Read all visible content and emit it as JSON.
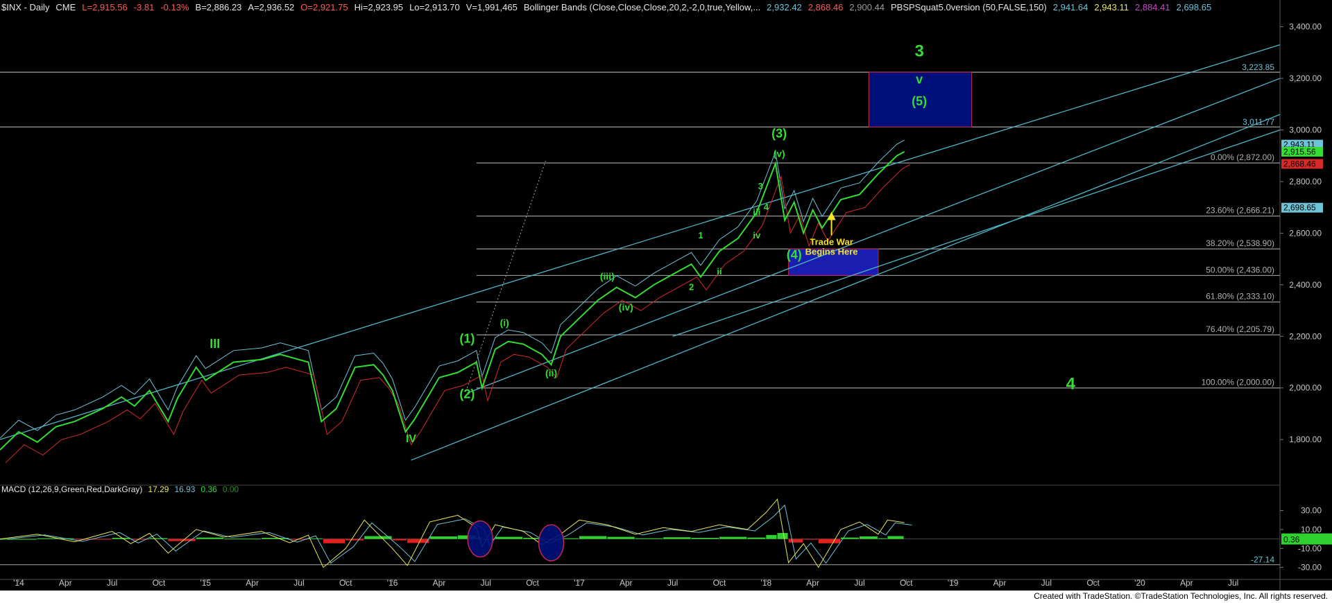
{
  "header": {
    "symbol": "$INX - Daily",
    "exchange": "CME",
    "last": "L=2,915.56",
    "chg": "-3.81",
    "chgpct": "-0.13%",
    "bid": "B=2,886.23",
    "ask": "A=2,936.52",
    "open": "O=2,921.75",
    "high": "Hi=2,923.95",
    "low": "Lo=2,913.70",
    "vol": "V=1,991,465",
    "bb_label": "Bollinger Bands (Close,Close,Close,20,2,-2,0,true,Yellow,...",
    "bb_v1": "2,932.42",
    "bb_v2": "2,868.46",
    "bb_v3": "2,900.44",
    "pbs_label": "PBSPSquat5.0version (50,FALSE,150)",
    "pbs_v1": "2,941.64",
    "pbs_v2": "2,943.11",
    "pbs_v3": "2,884.41",
    "pbs_v4": "2,698.65"
  },
  "macd_header": {
    "label": "MACD (12,26,9,Green,Red,DarkGray)",
    "v1": "17.29",
    "v2": "16.93",
    "v3": "0.36",
    "v4": "0.00"
  },
  "footer": "Created with TradeStation. ©TradeStation Technologies, Inc. All rights reserved.",
  "colors": {
    "price": "#33dd33",
    "bb_upper": "#6fc3d6",
    "bb_lower": "#d42a2a",
    "channel": "#4fb7c9",
    "wave_label": "#33dd33",
    "fib_label": "#b0b0b0",
    "box": "#00107a"
  },
  "chart_data": {
    "type": "line",
    "title": "$INX - Daily",
    "x_ticks": [
      "'14",
      "Apr",
      "Jul",
      "Oct",
      "'15",
      "Apr",
      "Jul",
      "Oct",
      "'16",
      "Apr",
      "Jul",
      "Oct",
      "'17",
      "Apr",
      "Jul",
      "Oct",
      "'18",
      "Apr",
      "Jul",
      "Oct",
      "'19",
      "Apr",
      "Jul",
      "Oct",
      "'20",
      "Apr",
      "Jul"
    ],
    "ylim": [
      1650,
      3450
    ],
    "y_ticks": [
      "3,400.00",
      "3,200.00",
      "3,000.00",
      "2,800.00",
      "2,600.00",
      "2,400.00",
      "2,200.00",
      "2,000.00",
      "1,800.00"
    ],
    "price_path": [
      [
        2013.9,
        1760
      ],
      [
        2014.0,
        1830
      ],
      [
        2014.1,
        1790
      ],
      [
        2014.2,
        1850
      ],
      [
        2014.3,
        1870
      ],
      [
        2014.45,
        1920
      ],
      [
        2014.55,
        1965
      ],
      [
        2014.62,
        1930
      ],
      [
        2014.7,
        1990
      ],
      [
        2014.8,
        1870
      ],
      [
        2014.85,
        1960
      ],
      [
        2014.95,
        2080
      ],
      [
        2015.0,
        2030
      ],
      [
        2015.15,
        2100
      ],
      [
        2015.3,
        2110
      ],
      [
        2015.4,
        2130
      ],
      [
        2015.55,
        2100
      ],
      [
        2015.62,
        1870
      ],
      [
        2015.7,
        1920
      ],
      [
        2015.8,
        2080
      ],
      [
        2015.9,
        2090
      ],
      [
        2015.95,
        2050
      ],
      [
        2016.0,
        1990
      ],
      [
        2016.07,
        1830
      ],
      [
        2016.12,
        1880
      ],
      [
        2016.25,
        2040
      ],
      [
        2016.35,
        2060
      ],
      [
        2016.45,
        2100
      ],
      [
        2016.48,
        2000
      ],
      [
        2016.55,
        2150
      ],
      [
        2016.62,
        2180
      ],
      [
        2016.7,
        2170
      ],
      [
        2016.8,
        2130
      ],
      [
        2016.85,
        2090
      ],
      [
        2016.9,
        2200
      ],
      [
        2017.0,
        2270
      ],
      [
        2017.1,
        2340
      ],
      [
        2017.2,
        2390
      ],
      [
        2017.3,
        2350
      ],
      [
        2017.4,
        2400
      ],
      [
        2017.5,
        2440
      ],
      [
        2017.6,
        2480
      ],
      [
        2017.65,
        2430
      ],
      [
        2017.75,
        2530
      ],
      [
        2017.85,
        2580
      ],
      [
        2017.95,
        2680
      ],
      [
        2018.05,
        2870
      ],
      [
        2018.1,
        2650
      ],
      [
        2018.15,
        2720
      ],
      [
        2018.2,
        2600
      ],
      [
        2018.25,
        2690
      ],
      [
        2018.3,
        2620
      ],
      [
        2018.4,
        2730
      ],
      [
        2018.5,
        2750
      ],
      [
        2018.6,
        2830
      ],
      [
        2018.7,
        2900
      ],
      [
        2018.74,
        2915.56
      ]
    ],
    "fib_levels": [
      {
        "label": "0.00% (2,872.00)",
        "value": 2872.0
      },
      {
        "label": "23.60% (2,666.21)",
        "value": 2666.21
      },
      {
        "label": "38.20% (2,538.90)",
        "value": 2538.9
      },
      {
        "label": "50.00% (2,436.00)",
        "value": 2436.0
      },
      {
        "label": "61.80% (2,333.10)",
        "value": 2333.1
      },
      {
        "label": "76.40% (2,205.79)",
        "value": 2205.79
      },
      {
        "label": "100.00% (2,000.00)",
        "value": 2000.0
      }
    ],
    "target_lines": [
      {
        "label": "3,223.85",
        "value": 3223.85
      },
      {
        "label": "3,011.77",
        "value": 3011.77
      }
    ],
    "right_badges": [
      {
        "label": "2,943.11",
        "value": 2943.11,
        "color": "#6fc3d6"
      },
      {
        "label": "2,915.56",
        "value": 2915.56,
        "color": "#33dd33"
      },
      {
        "label": "2,868.46",
        "value": 2868.46,
        "color": "#d42a2a"
      },
      {
        "label": "2,698.65",
        "value": 2698.65,
        "color": "#6fc3d6"
      }
    ],
    "wave_labels": [
      {
        "text": "III",
        "x": 2015.05,
        "y": 2155,
        "size": 18
      },
      {
        "text": "IV",
        "x": 2016.1,
        "y": 1790,
        "size": 16
      },
      {
        "text": "(1)",
        "x": 2016.4,
        "y": 2175,
        "size": 18
      },
      {
        "text": "(2)",
        "x": 2016.4,
        "y": 1960,
        "size": 18
      },
      {
        "text": "(i)",
        "x": 2016.6,
        "y": 2240,
        "size": 14
      },
      {
        "text": "(ii)",
        "x": 2016.85,
        "y": 2045,
        "size": 14
      },
      {
        "text": "(iii)",
        "x": 2017.15,
        "y": 2420,
        "size": 14
      },
      {
        "text": "(iv)",
        "x": 2017.25,
        "y": 2300,
        "size": 14
      },
      {
        "text": "1",
        "x": 2017.65,
        "y": 2580,
        "size": 13
      },
      {
        "text": "2",
        "x": 2017.6,
        "y": 2380,
        "size": 13
      },
      {
        "text": "ii",
        "x": 2017.75,
        "y": 2440,
        "size": 13
      },
      {
        "text": "iii",
        "x": 2017.95,
        "y": 2670,
        "size": 13
      },
      {
        "text": "iv",
        "x": 2017.95,
        "y": 2580,
        "size": 13
      },
      {
        "text": "3",
        "x": 2017.97,
        "y": 2770,
        "size": 13
      },
      {
        "text": "4",
        "x": 2018.0,
        "y": 2690,
        "size": 13
      },
      {
        "text": "(3)",
        "x": 2018.07,
        "y": 2970,
        "size": 18
      },
      {
        "text": "(v)",
        "x": 2018.07,
        "y": 2895,
        "size": 14
      },
      {
        "text": "(4)",
        "x": 2018.15,
        "y": 2500,
        "size": 18
      },
      {
        "text": "3",
        "x": 2018.82,
        "y": 3285,
        "size": 24
      },
      {
        "text": "v",
        "x": 2018.82,
        "y": 3180,
        "size": 18
      },
      {
        "text": "(5)",
        "x": 2018.82,
        "y": 3095,
        "size": 18
      },
      {
        "text": "4",
        "x": 2019.63,
        "y": 1995,
        "size": 24
      }
    ],
    "annotation": {
      "line1": "Trade War",
      "line2": "Begins Here",
      "x": 2018.35,
      "y": 2570
    },
    "target_box_upper": {
      "x0": 2018.55,
      "x1": 2019.1,
      "y0": 3011.77,
      "y1": 3223.85
    },
    "target_box_lower": {
      "x0": 2018.12,
      "x1": 2018.6,
      "y0": 2436.0,
      "y1": 2538.9
    },
    "macd": {
      "ylim": [
        -42,
        48
      ],
      "y_ticks": [
        "30.00",
        "10.00",
        "-10.00",
        "-30.00"
      ],
      "ref_line": {
        "label": "-27.14",
        "value": -27.14
      },
      "last_badge": "0.36",
      "path": [
        [
          2013.9,
          0
        ],
        [
          2014.1,
          5
        ],
        [
          2014.3,
          -3
        ],
        [
          2014.5,
          8
        ],
        [
          2014.6,
          -5
        ],
        [
          2014.7,
          6
        ],
        [
          2014.8,
          -15
        ],
        [
          2014.95,
          10
        ],
        [
          2015.1,
          2
        ],
        [
          2015.3,
          8
        ],
        [
          2015.45,
          -4
        ],
        [
          2015.55,
          4
        ],
        [
          2015.63,
          -30
        ],
        [
          2015.75,
          -10
        ],
        [
          2015.85,
          20
        ],
        [
          2016.0,
          -10
        ],
        [
          2016.08,
          -28
        ],
        [
          2016.2,
          18
        ],
        [
          2016.35,
          25
        ],
        [
          2016.45,
          12
        ],
        [
          2016.48,
          -8
        ],
        [
          2016.55,
          15
        ],
        [
          2016.7,
          8
        ],
        [
          2016.8,
          -6
        ],
        [
          2016.9,
          5
        ],
        [
          2017.0,
          20
        ],
        [
          2017.15,
          15
        ],
        [
          2017.3,
          5
        ],
        [
          2017.45,
          12
        ],
        [
          2017.6,
          8
        ],
        [
          2017.75,
          15
        ],
        [
          2017.9,
          10
        ],
        [
          2018.0,
          28
        ],
        [
          2018.06,
          42
        ],
        [
          2018.12,
          -25
        ],
        [
          2018.2,
          -5
        ],
        [
          2018.28,
          -30
        ],
        [
          2018.4,
          10
        ],
        [
          2018.5,
          18
        ],
        [
          2018.6,
          5
        ],
        [
          2018.65,
          20
        ],
        [
          2018.74,
          17.29
        ]
      ]
    }
  }
}
